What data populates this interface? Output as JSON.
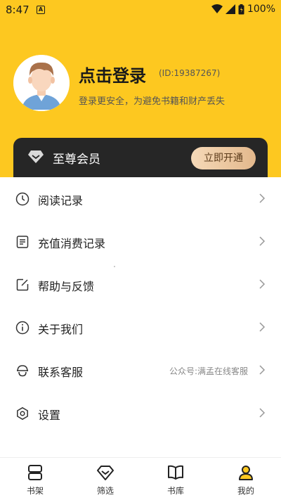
{
  "status_bar": {
    "time": "8:47",
    "battery": "100%"
  },
  "profile": {
    "login_title": "点击登录",
    "user_id": "(ID:19387267)",
    "subtitle": "登录更安全，为避免书籍和财产丢失"
  },
  "vip": {
    "label": "至尊会员",
    "button": "立即开通"
  },
  "menu": [
    {
      "label": "阅读记录",
      "icon": "clock-icon"
    },
    {
      "label": "充值消费记录",
      "icon": "receipt-icon"
    },
    {
      "label": "帮助与反馈",
      "icon": "edit-icon"
    },
    {
      "label": "关于我们",
      "icon": "info-icon"
    },
    {
      "label": "联系客服",
      "icon": "headset-icon",
      "extra": "公众号:满孟在线客服"
    },
    {
      "label": "设置",
      "icon": "settings-icon"
    }
  ],
  "bottom_nav": [
    {
      "label": "书架",
      "icon": "bookshelf-icon"
    },
    {
      "label": "筛选",
      "icon": "diamond-icon"
    },
    {
      "label": "书库",
      "icon": "book-icon"
    },
    {
      "label": "我的",
      "icon": "user-icon",
      "active": true
    }
  ],
  "colors": {
    "brand_yellow": "#FDC820",
    "vip_dark": "#262626",
    "vip_gold": "#E3B88C"
  }
}
